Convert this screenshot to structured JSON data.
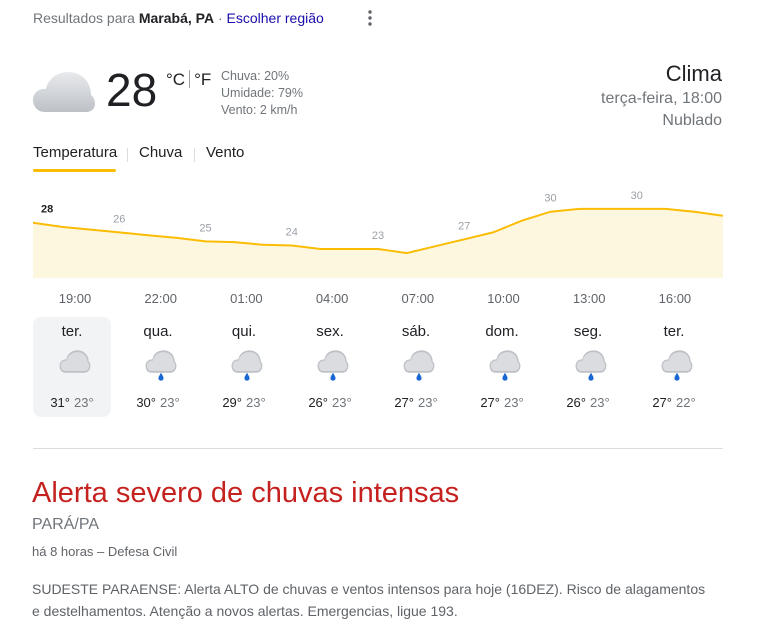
{
  "location_bar": {
    "prefix": "Resultados para",
    "location": "Marabá, PA",
    "separator": "·",
    "change_region": "Escolher região"
  },
  "current": {
    "icon": "cloud-icon",
    "temperature": "28",
    "unit_c": "°C",
    "unit_f": "°F",
    "rain": "Chuva: 20%",
    "humidity": "Umidade: 79%",
    "wind": "Vento: 2 km/h",
    "title": "Clima",
    "datetime": "terça-feira, 18:00",
    "condition": "Nublado"
  },
  "tabs": [
    {
      "label": "Temperatura",
      "active": true
    },
    {
      "label": "Chuva",
      "active": false
    },
    {
      "label": "Vento",
      "active": false
    }
  ],
  "chart_data": {
    "type": "area",
    "x": [
      "18:00",
      "19:00",
      "20:00",
      "21:00",
      "22:00",
      "23:00",
      "00:00",
      "01:00",
      "02:00",
      "03:00",
      "04:00",
      "05:00",
      "06:00",
      "07:00",
      "08:00",
      "09:00",
      "10:00",
      "11:00",
      "12:00",
      "13:00",
      "14:00",
      "15:00",
      "16:00",
      "17:00",
      "18:00"
    ],
    "values": [
      28,
      27.4,
      27,
      26.6,
      26.2,
      25.8,
      25.3,
      25.2,
      24.8,
      24.7,
      24.2,
      24.2,
      24.2,
      23.6,
      24.6,
      25.6,
      26.6,
      28.3,
      29.6,
      30,
      30,
      30,
      30,
      29.6,
      29
    ],
    "labels": [
      {
        "x": "18:00",
        "text": "28"
      },
      {
        "x": "21:00",
        "text": "26"
      },
      {
        "x": "00:00",
        "text": "25"
      },
      {
        "x": "03:00",
        "text": "24"
      },
      {
        "x": "06:00",
        "text": "23"
      },
      {
        "x": "09:00",
        "text": "27"
      },
      {
        "x": "12:00",
        "text": "30"
      },
      {
        "x": "15:00",
        "text": "30"
      }
    ],
    "tick_labels": [
      "19:00",
      "22:00",
      "01:00",
      "04:00",
      "07:00",
      "10:00",
      "13:00",
      "16:00"
    ],
    "ylim": [
      20,
      31
    ],
    "line_color": "#fbbc04",
    "fill_color": "#fef7e0"
  },
  "forecast": [
    {
      "day": "ter.",
      "icon": "cloud-icon",
      "high": "31°",
      "low": "23°",
      "active": true
    },
    {
      "day": "qua.",
      "icon": "rain-cloud-icon",
      "high": "30°",
      "low": "23°",
      "active": false
    },
    {
      "day": "qui.",
      "icon": "rain-cloud-icon",
      "high": "29°",
      "low": "23°",
      "active": false
    },
    {
      "day": "sex.",
      "icon": "rain-cloud-icon",
      "high": "26°",
      "low": "23°",
      "active": false
    },
    {
      "day": "sáb.",
      "icon": "rain-cloud-icon",
      "high": "27°",
      "low": "23°",
      "active": false
    },
    {
      "day": "dom.",
      "icon": "rain-cloud-icon",
      "high": "27°",
      "low": "23°",
      "active": false
    },
    {
      "day": "seg.",
      "icon": "rain-cloud-icon",
      "high": "26°",
      "low": "23°",
      "active": false
    },
    {
      "day": "ter.",
      "icon": "rain-cloud-icon",
      "high": "27°",
      "low": "22°",
      "active": false
    }
  ],
  "alert": {
    "title": "Alerta severo de chuvas intensas",
    "region": "PARÁ/PA",
    "meta": "há 8 horas – Defesa Civil",
    "description": "SUDESTE PARAENSE: Alerta ALTO de chuvas e ventos intensos para hoje (16DEZ). Risco de alagamentos e destelhamentos. Atenção a novos alertas. Emergencias, ligue 193.",
    "color": "#c5221f"
  }
}
